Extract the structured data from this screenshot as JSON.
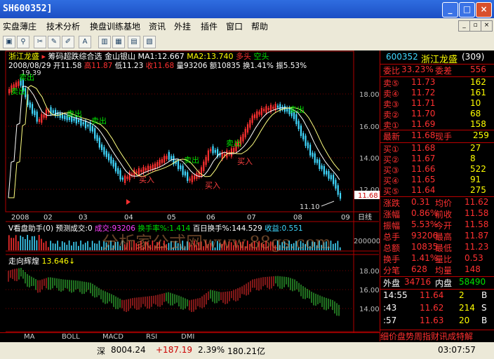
{
  "window": {
    "title": "SH600352]"
  },
  "menu": [
    "实盘薄庄",
    "技术分析",
    "换盘训练基地",
    "资讯",
    "外挂",
    "插件",
    "窗口",
    "帮助"
  ],
  "toolbar_icons": [
    "window-icon",
    "search-icon",
    "scissors-icon",
    "pen-icon",
    "marker-icon",
    "text-icon",
    "candlestick-icon",
    "grid-icon",
    "chart-icon"
  ],
  "header": {
    "stock_name": "浙江龙盛",
    "indicator": "筹码超跌综合选 金山银山",
    "ma1": "MA1:12.667",
    "ma2": "MA2:13.740",
    "trend1": "多头",
    "trend2": "空头",
    "date": "2008/08/29",
    "open": "开11.58",
    "high": "高11.87",
    "low": "低11.23",
    "close": "收11.68",
    "volume": "量93206",
    "amount": "额10835",
    "turnover": "换1.41%",
    "amplitude": "振5.53%"
  },
  "main_chart": {
    "price_labels": [
      "18.00",
      "16.00",
      "14.00",
      "12.00"
    ],
    "high_mark": "19.39",
    "low_mark": "11.10",
    "current_price": "11.68",
    "sell_labels": [
      "卖出",
      "卖出",
      "卖出",
      "卖出",
      "卖出",
      "卖出",
      "卖出",
      "卖出"
    ],
    "buy_labels": [
      "买入",
      "买入",
      "买入"
    ],
    "x_labels": [
      "2008",
      "02",
      "03",
      "04",
      "05",
      "06",
      "07",
      "08",
      "09"
    ],
    "period": "日线"
  },
  "volume_panel": {
    "title": "V看盘助手(0)",
    "forecast": "预测成交:0",
    "deal": "成交:93206",
    "turnover": "换手率%:1.414",
    "hundred": "百日换手%:144.529",
    "profit": "收益:0.551",
    "axis": "200000"
  },
  "trend_panel": {
    "title": "走向辉煌",
    "value": "13.646",
    "labels": [
      "18.00",
      "16.00",
      "14.00"
    ]
  },
  "tabs": [
    "MA",
    "BOLL",
    "MACD",
    "RSI",
    "DMI"
  ],
  "quote": {
    "code": "600352",
    "name": "浙江龙盛",
    "num": "(309)",
    "weibi_label": "委比",
    "weibi": "33.23%",
    "weicha_label": "委差",
    "weicha": "556",
    "sells": [
      {
        "label": "卖⑤",
        "price": "11.73",
        "vol": "162"
      },
      {
        "label": "卖④",
        "price": "11.72",
        "vol": "161"
      },
      {
        "label": "卖③",
        "price": "11.71",
        "vol": "10"
      },
      {
        "label": "卖②",
        "price": "11.70",
        "vol": "68"
      },
      {
        "label": "卖①",
        "price": "11.69",
        "vol": "158"
      }
    ],
    "latest_label": "最新",
    "latest": "11.68",
    "xianshou_label": "现手",
    "xianshou": "259",
    "buys": [
      {
        "label": "买①",
        "price": "11.68",
        "vol": "27"
      },
      {
        "label": "买②",
        "price": "11.67",
        "vol": "8"
      },
      {
        "label": "买③",
        "price": "11.66",
        "vol": "522"
      },
      {
        "label": "买④",
        "price": "11.65",
        "vol": "91"
      },
      {
        "label": "买⑤",
        "price": "11.64",
        "vol": "275"
      }
    ],
    "stats": [
      {
        "l1": "涨跌",
        "v1": "0.31",
        "l2": "均价",
        "v2": "11.62"
      },
      {
        "l1": "涨幅",
        "v1": "0.86%",
        "l2": "前收",
        "v2": "11.58"
      },
      {
        "l1": "振幅",
        "v1": "5.53%",
        "l2": "今开",
        "v2": "11.58"
      },
      {
        "l1": "总手",
        "v1": "93206",
        "l2": "最高",
        "v2": "11.87"
      },
      {
        "l1": "总额",
        "v1": "10835",
        "l2": "最低",
        "v2": "11.23"
      },
      {
        "l1": "换手",
        "v1": "1.41%",
        "l2": "量比",
        "v2": "0.53"
      },
      {
        "l1": "分笔",
        "v1": "628",
        "l2": "均量",
        "v2": "148"
      }
    ],
    "waipan_label": "外盘",
    "waipan": "34716",
    "neipan_label": "内盘",
    "neipan": "58490",
    "ticks": [
      {
        "time": "14:55",
        "price": "11.64",
        "vol": "2",
        "side": "B"
      },
      {
        "time": ":43",
        "price": "11.62",
        "vol": "214",
        "side": "S"
      },
      {
        "time": ":57",
        "price": "11.63",
        "vol": "20",
        "side": "B"
      }
    ],
    "bottom_tabs": "细价盘势周指财讯成特解"
  },
  "status": {
    "market": "深",
    "index": "8004.24",
    "change": "+187.19",
    "pct": "2.39%",
    "amount": "180.21亿",
    "time": "03:07:57"
  },
  "watermark": "分析家公式网www.88gs.com",
  "colors": {
    "up": "#ff3030",
    "down": "#40d8ff",
    "ma1": "#ffffff",
    "ma2": "#ffff80",
    "frame": "#b00000"
  }
}
